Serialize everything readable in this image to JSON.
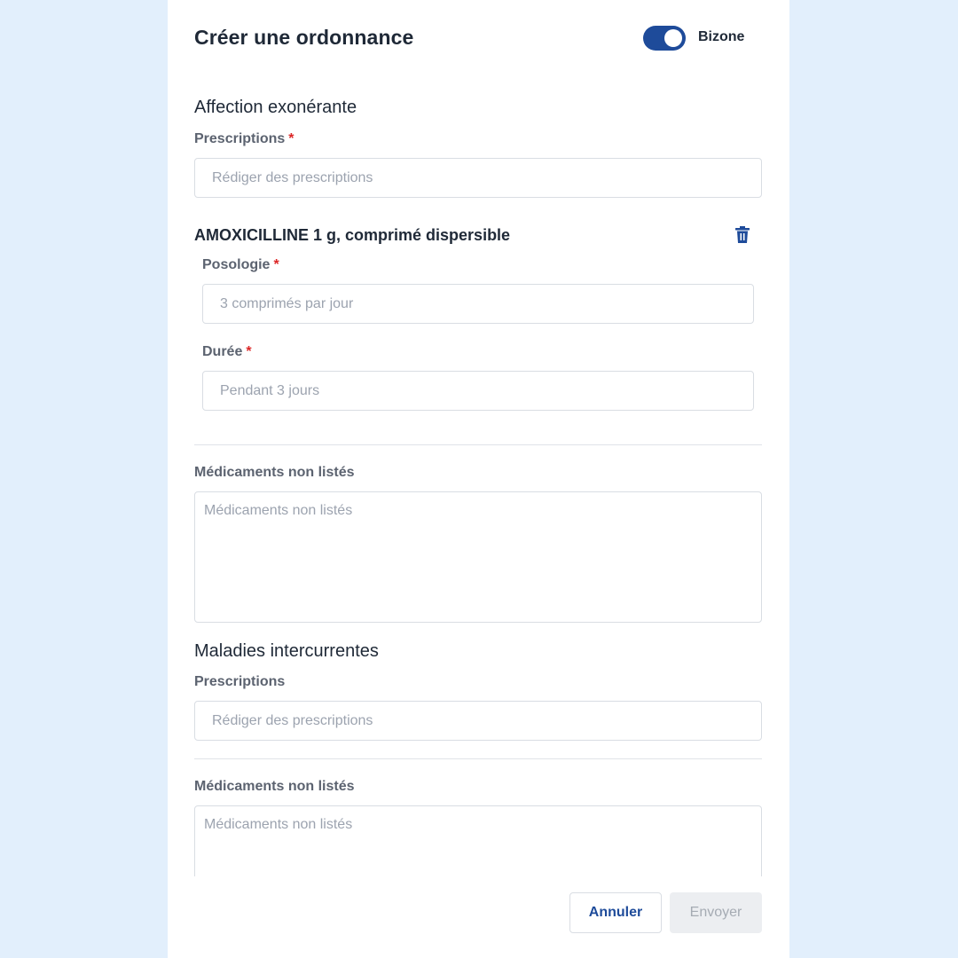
{
  "header": {
    "title": "Créer une ordonnance",
    "toggle": {
      "label": "Bizone",
      "on": true,
      "color": "#1e4b9a"
    }
  },
  "affection_exonerante": {
    "section_title": "Affection exonérante",
    "prescriptions_label": "Prescriptions",
    "required_mark": "*",
    "prescriptions_placeholder": "Rédiger des prescriptions",
    "medication": {
      "name": "AMOXICILLINE 1 g, comprimé dispersible",
      "delete_icon": "trash-icon",
      "posologie_label": "Posologie",
      "posologie_placeholder": "3 comprimés par jour",
      "duree_label": "Durée",
      "duree_placeholder": "Pendant 3 jours"
    },
    "unlisted_label": "Médicaments non listés",
    "unlisted_placeholder": "Médicaments non listés"
  },
  "maladies_intercurrentes": {
    "section_title": "Maladies intercurrentes",
    "prescriptions_label": "Prescriptions",
    "prescriptions_placeholder": "Rédiger des prescriptions",
    "unlisted_label": "Médicaments non listés",
    "unlisted_placeholder": "Médicaments non listés"
  },
  "footer": {
    "cancel_label": "Annuler",
    "send_label": "Envoyer",
    "send_disabled": true
  },
  "colors": {
    "background": "#e2effc",
    "accent": "#1e4b9a",
    "required": "#dc2626"
  }
}
